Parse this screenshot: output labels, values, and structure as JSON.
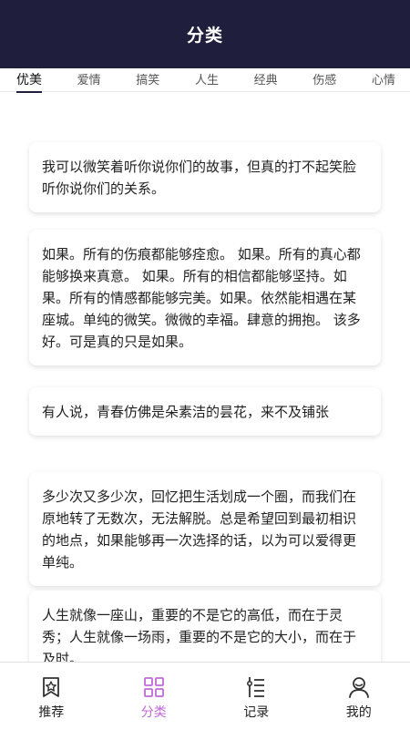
{
  "header": {
    "title": "分类"
  },
  "tabs": [
    {
      "label": "优美",
      "active": true
    },
    {
      "label": "爱情",
      "active": false
    },
    {
      "label": "搞笑",
      "active": false
    },
    {
      "label": "人生",
      "active": false
    },
    {
      "label": "经典",
      "active": false
    },
    {
      "label": "伤感",
      "active": false
    },
    {
      "label": "心情",
      "active": false
    }
  ],
  "cards": [
    {
      "text": "我可以微笑着听你说你们的故事，但真的打不起笑脸听你说你们的关系。"
    },
    {
      "text": "如果。所有的伤痕都能够痊愈。 如果。所有的真心都能够换来真意。 如果。所有的相信都能够坚持。如果。所有的情感都能够完美。如果。依然能相遇在某座城。单纯的微笑。微微的幸福。肆意的拥抱。 该多好。可是真的只是如果。"
    },
    {
      "text": "有人说，青春仿佛是朵素洁的昙花，来不及铺张"
    },
    {
      "text": "多少次又多少次，回忆把生活划成一个圈，而我们在原地转了无数次，无法解脱。总是希望回到最初相识的地点，如果能够再一次选择的话，以为可以爱得更单纯。"
    },
    {
      "text": "人生就像一座山，重要的不是它的高低，而在于灵秀；人生就像一场雨，重要的不是它的大小，而在于及时。"
    }
  ],
  "nav": [
    {
      "label": "推荐",
      "icon": "star-tag-icon",
      "active": false
    },
    {
      "label": "分类",
      "icon": "grid-icon",
      "active": true
    },
    {
      "label": "记录",
      "icon": "list-icon",
      "active": false
    },
    {
      "label": "我的",
      "icon": "user-icon",
      "active": false
    }
  ],
  "colors": {
    "header_bg": "#1f1f3d",
    "accent": "#c06ad6"
  }
}
